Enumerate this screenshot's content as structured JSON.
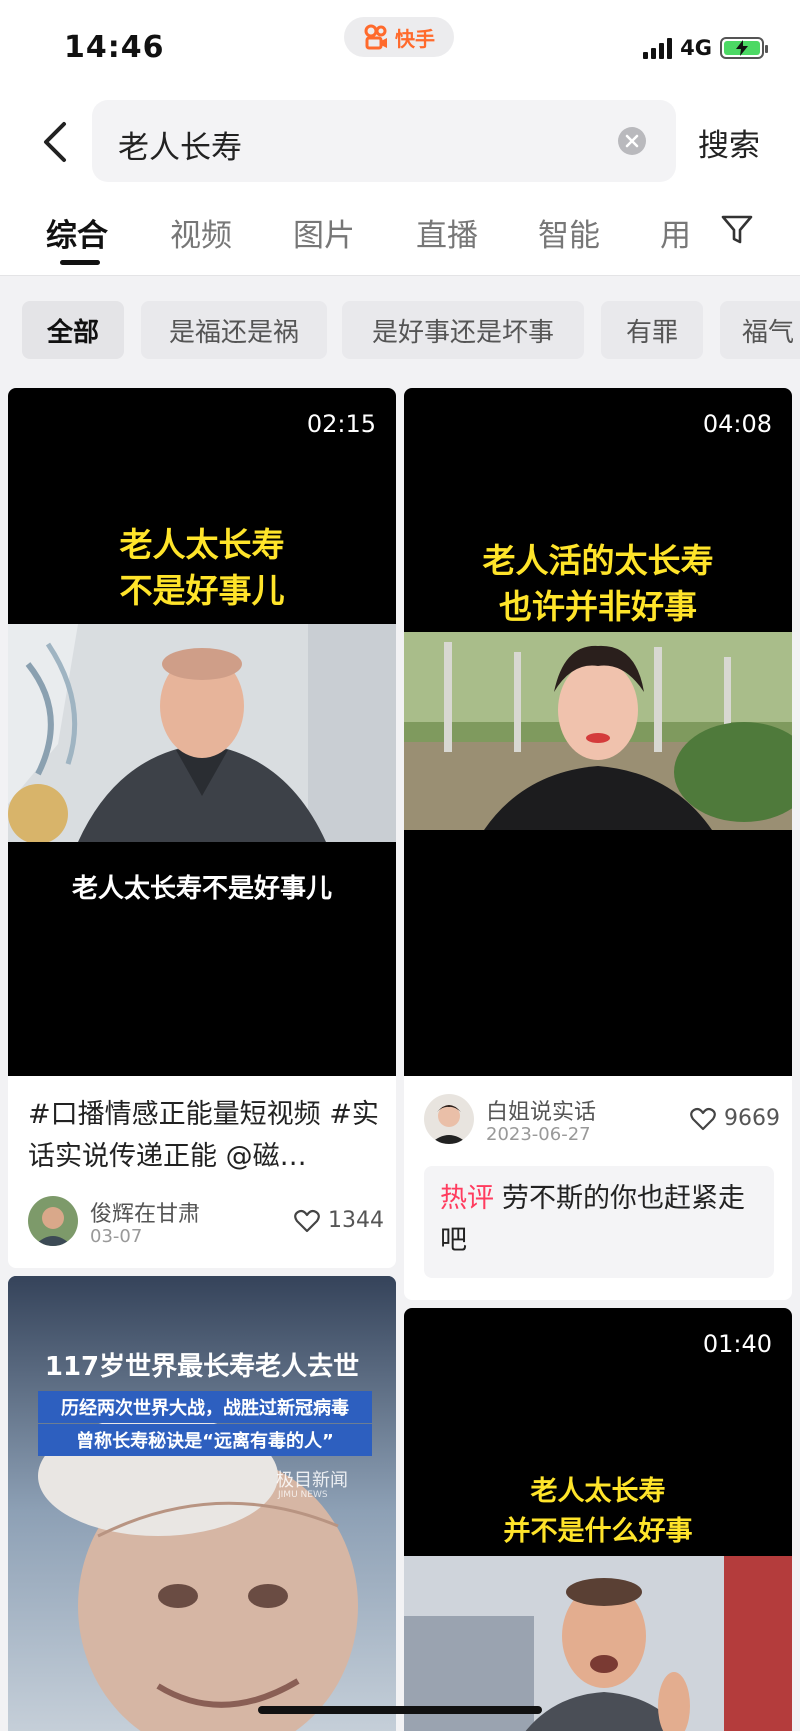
{
  "status_bar": {
    "time": "14:46",
    "app_name": "快手",
    "network": "4G"
  },
  "search": {
    "query": "老人长寿",
    "button_label": "搜索"
  },
  "tabs": [
    {
      "label": "综合",
      "active": true
    },
    {
      "label": "视频",
      "active": false
    },
    {
      "label": "图片",
      "active": false
    },
    {
      "label": "直播",
      "active": false
    },
    {
      "label": "智能",
      "active": false
    },
    {
      "label": "用",
      "active": false
    }
  ],
  "chips": [
    {
      "label": "全部",
      "active": true
    },
    {
      "label": "是福还是祸",
      "active": false
    },
    {
      "label": "是好事还是坏事",
      "active": false
    },
    {
      "label": "有罪",
      "active": false
    },
    {
      "label": "福气",
      "active": false
    }
  ],
  "cards": [
    {
      "duration": "02:15",
      "overlay_title": "老人太长寿\n不是好事儿",
      "subtitle": "老人太长寿不是好事儿",
      "description": "#口播情感正能量短视频 #实话实说传递正能 @磁…",
      "author": "俊辉在甘肃",
      "date": "03-07",
      "likes": "1344"
    },
    {
      "duration": "04:08",
      "overlay_title": "老人活的太长寿\n也许并非好事",
      "author": "白姐说实话",
      "date": "2023-06-27",
      "likes": "9669",
      "comment_tag": "热评",
      "comment": "劳不斯的你也赶紧走吧"
    },
    {
      "headline": "117岁世界最长寿老人去世",
      "subline1": "历经两次世界大战，战胜过新冠病毒",
      "subline2": "曾称长寿秘诀是“远离有毒的人”",
      "watermark": "极目新闻",
      "watermark_en": "JIMU NEWS"
    },
    {
      "duration": "01:40",
      "overlay_title": "老人太长寿\n并不是什么好事"
    }
  ],
  "colors": {
    "accent": "#ff6a2c",
    "hot_comment": "#ff3c5f",
    "caption_yellow": "#ffe42a",
    "battery": "#4cd964"
  }
}
